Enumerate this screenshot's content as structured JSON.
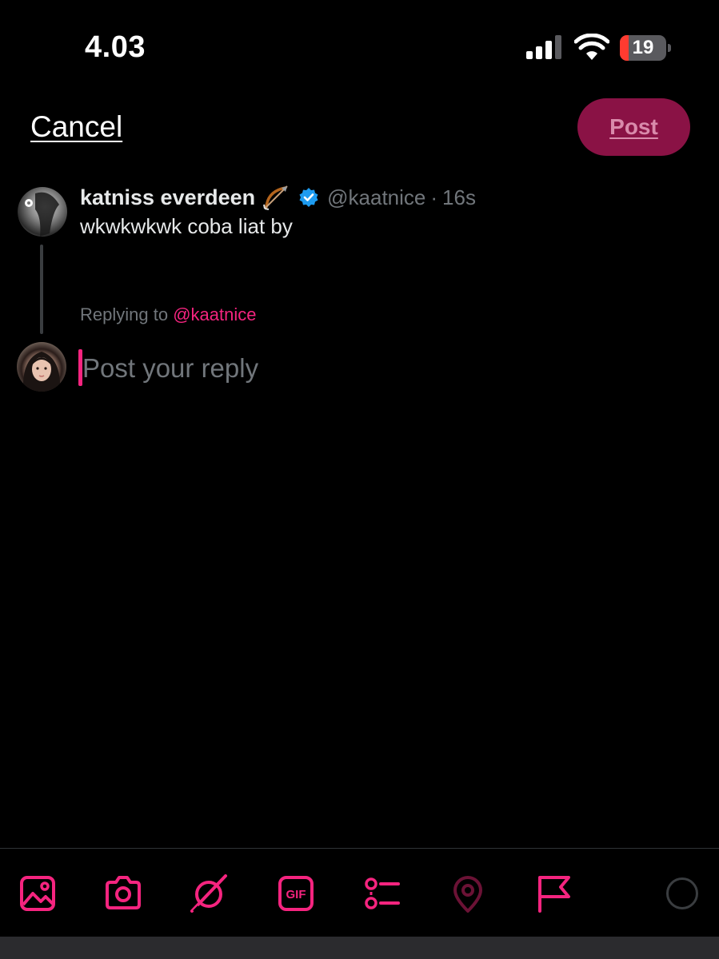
{
  "status_bar": {
    "time": "4.03",
    "battery_level": "19",
    "battery_fraction": 0.19
  },
  "header": {
    "cancel_label": "Cancel",
    "post_label": "Post"
  },
  "original_post": {
    "author_name": "katniss everdeen",
    "author_emoji": "bow-and-arrow-icon",
    "verified": true,
    "handle": "@kaatnice",
    "separator": "·",
    "timestamp": "16s",
    "text": "wkwkwkwk coba liat by"
  },
  "reply": {
    "replying_prefix": "Replying to",
    "replying_handle": "@kaatnice",
    "placeholder": "Post your reply",
    "value": ""
  },
  "toolbar": {
    "icons": [
      "image-icon",
      "camera-icon",
      "grok-icon",
      "gif-icon",
      "poll-icon",
      "location-icon",
      "flag-icon",
      "character-counter"
    ],
    "gif_label": "GIF"
  },
  "colors": {
    "accent": "#f5247f",
    "post_button_bg": "#8a1245",
    "post_button_text": "#d98aab",
    "muted_text": "#71767b",
    "primary_text": "#e7e9ea",
    "background": "#000000",
    "verified": "#1d9bf0",
    "battery_low": "#ff3b30"
  }
}
